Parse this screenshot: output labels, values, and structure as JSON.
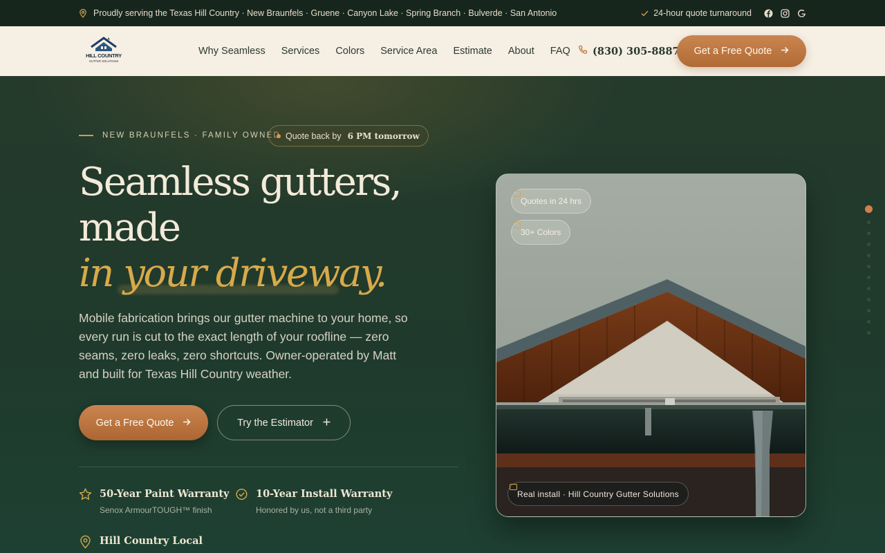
{
  "topbar": {
    "service_area": "Proudly serving the Texas Hill Country · New Braunfels · Gruene · Canyon Lake · Spring Branch · Bulverde · San Antonio",
    "turnaround": "24-hour quote turnaround",
    "social_icons": [
      "facebook-icon",
      "instagram-icon",
      "google-icon"
    ]
  },
  "nav": {
    "logo_text": "HILL COUNTRY GUTTER SOLUTIONS",
    "links": [
      "Why Seamless",
      "Services",
      "Colors",
      "Service Area",
      "Estimate",
      "About",
      "FAQ"
    ],
    "phone": "(830) 305-8887",
    "cta": "Get a Free Quote"
  },
  "hero": {
    "eyebrow": "NEW BRAUNFELS · FAMILY OWNED",
    "pill_prefix": "Quote back by",
    "pill_time": "6 PM tomorrow",
    "headline_1": "Seamless gutters,",
    "headline_2": "made",
    "headline_3": "in your driveway.",
    "lede": "Mobile fabrication brings our gutter machine to your home, so every run is cut to the exact length of your roofline — zero seams, zero leaks, zero shortcuts. Owner-operated by Matt and built for Texas Hill Country weather.",
    "primary_cta": "Get a Free Quote",
    "secondary_cta": "Try the Estimator",
    "features": [
      {
        "title": "50-Year Paint Warranty",
        "subtitle": "Senox ArmourTOUGH™ finish",
        "icon": "star-icon"
      },
      {
        "title": "10-Year Install Warranty",
        "subtitle": "Honored by us, not a third party",
        "icon": "check-circle-icon"
      },
      {
        "title": "Hill Country Local",
        "icon": "map-pin-icon"
      }
    ]
  },
  "card": {
    "chips": [
      "Quotes in 24 hrs",
      "30+ Colors"
    ],
    "caption": "Real install · Hill Country Gutter Solutions"
  },
  "colors": {
    "accent": "#c07a44",
    "gold": "#d8a94a",
    "dark_green": "#1f3a2c",
    "cream": "#f6efe4"
  }
}
